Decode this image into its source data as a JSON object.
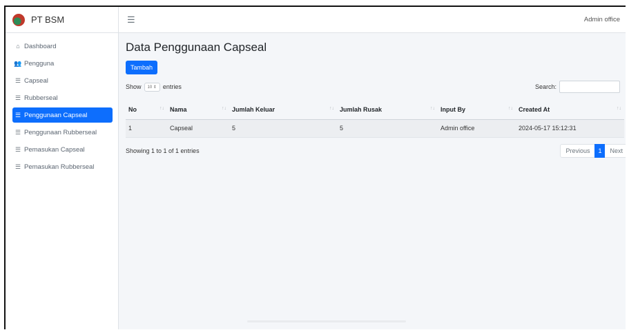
{
  "brand": {
    "name": "PT BSM"
  },
  "topbar": {
    "user": "Admin office"
  },
  "sidebar": {
    "items": [
      {
        "label": "Dashboard",
        "icon": "⌂"
      },
      {
        "label": "Pengguna",
        "icon": "👥"
      },
      {
        "label": "Capseal",
        "icon": "☰"
      },
      {
        "label": "Rubberseal",
        "icon": "☰"
      },
      {
        "label": "Penggunaan Capseal",
        "icon": "☰"
      },
      {
        "label": "Penggunaan Rubberseal",
        "icon": "☰"
      },
      {
        "label": "Pemasukan Capseal",
        "icon": "☰"
      },
      {
        "label": "Pemasukan Rubberseal",
        "icon": "☰"
      }
    ],
    "active_index": 4
  },
  "main": {
    "title": "Data Penggunaan Capseal",
    "add_button": "Tambah",
    "length": {
      "prefix": "Show",
      "value": "10",
      "suffix": "entries"
    },
    "search_label": "Search:",
    "table": {
      "columns": [
        "No",
        "Nama",
        "Jumlah Keluar",
        "Jumlah Rusak",
        "Input By",
        "Created At"
      ],
      "rows": [
        [
          "1",
          "Capseal",
          "5",
          "5",
          "Admin office",
          "2024-05-17 15:12:31"
        ]
      ]
    },
    "info": "Showing 1 to 1 of 1 entries",
    "pagination": {
      "previous": "Previous",
      "page": "1",
      "next": "Next"
    }
  },
  "colors": {
    "accent": "#0d6efd",
    "background": "#f4f6f9"
  }
}
